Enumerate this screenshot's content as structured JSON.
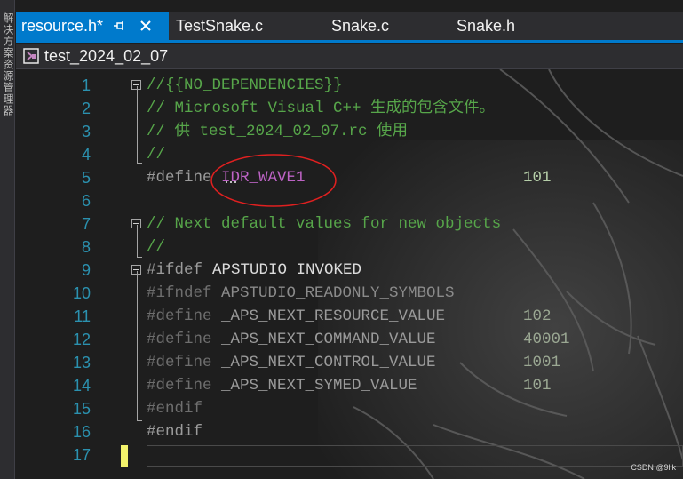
{
  "side_panel": {
    "vertical_text": "解决方案资源管理器"
  },
  "tabs": [
    {
      "label": "resource.h*",
      "active": true
    },
    {
      "label": "TestSnake.c",
      "active": false
    },
    {
      "label": "Snake.c",
      "active": false
    },
    {
      "label": "Snake.h",
      "active": false
    }
  ],
  "navbar": {
    "project": "test_2024_02_07"
  },
  "code": {
    "line_numbers": [
      "1",
      "2",
      "3",
      "4",
      "5",
      "6",
      "7",
      "8",
      "9",
      "10",
      "11",
      "12",
      "13",
      "14",
      "15",
      "16",
      "17"
    ],
    "l1": "//{{NO_DEPENDENCIES}}",
    "l2": "// Microsoft Visual C++ 生成的包含文件。",
    "l3": "// 供 test_2024_02_07.rc 使用",
    "l4": "//",
    "l5_kw": "#define",
    "l5_name": "IDR_WAVE1",
    "l5_val": "101",
    "l7": "// Next default values for new objects",
    "l8": "//",
    "l9_kw": "#ifdef",
    "l9_name": "APSTUDIO_INVOKED",
    "l10_kw": "#ifndef",
    "l10_name": "APSTUDIO_READONLY_SYMBOLS",
    "l11_kw": "#define",
    "l11_name": "_APS_NEXT_RESOURCE_VALUE",
    "l11_val": "102",
    "l12_kw": "#define",
    "l12_name": "_APS_NEXT_COMMAND_VALUE",
    "l12_val": "40001",
    "l13_kw": "#define",
    "l13_name": "_APS_NEXT_CONTROL_VALUE",
    "l13_val": "1001",
    "l14_kw": "#define",
    "l14_name": "_APS_NEXT_SYMED_VALUE",
    "l14_val": "101",
    "l15": "#endif",
    "l16": "#endif"
  },
  "watermark": "CSDN @9llk",
  "colors": {
    "accent": "#007acc",
    "comment": "#57a64a",
    "macro": "#bd63c5",
    "line_number": "#2b91af",
    "annotation": "#e02020",
    "caret_marker": "#f2f26b"
  },
  "icons": [
    "pin-icon",
    "close-icon",
    "project-icon"
  ]
}
